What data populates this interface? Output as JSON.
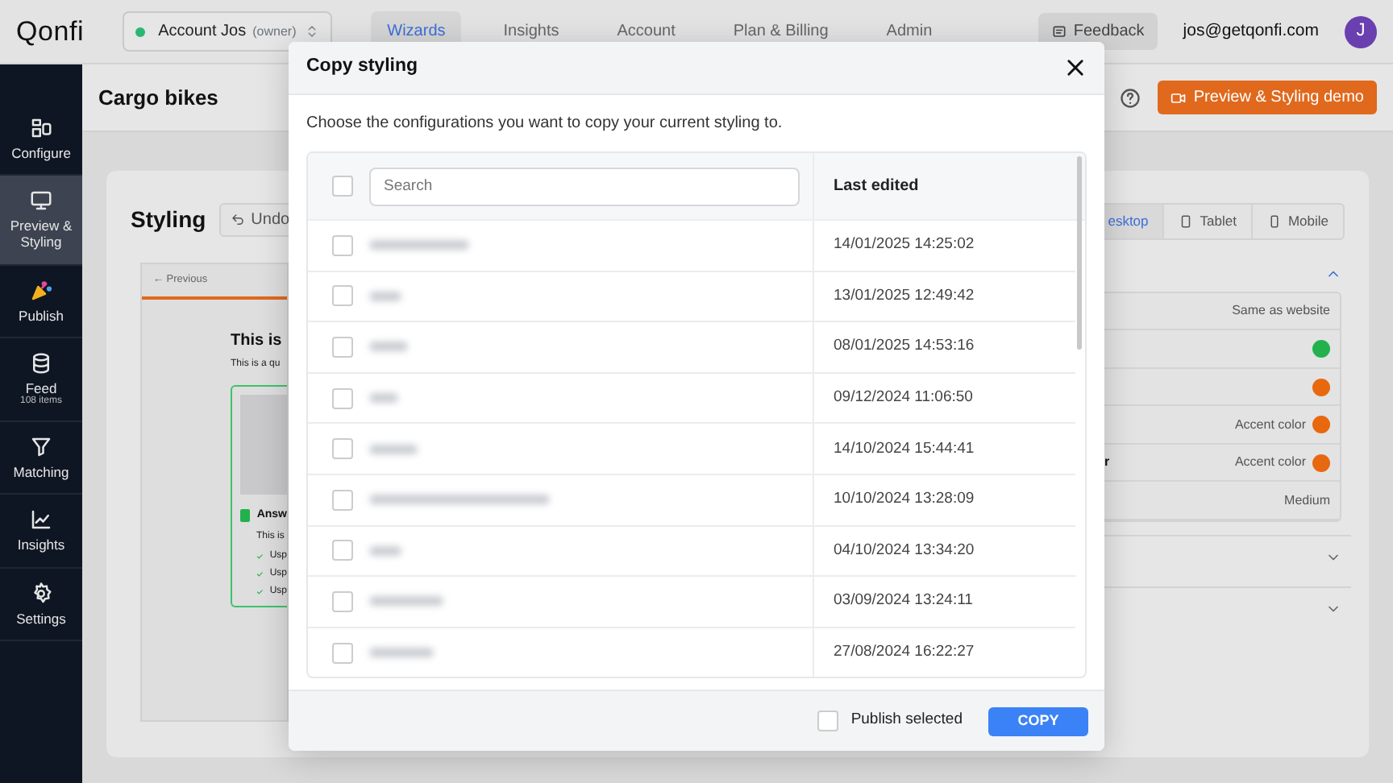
{
  "topbar": {
    "logo": "Qonfi",
    "account": {
      "name": "Account Jos",
      "role": "(owner)",
      "online": true
    },
    "nav": [
      {
        "label": "Wizards",
        "selected": true
      },
      {
        "label": "Insights",
        "selected": false
      },
      {
        "label": "Account",
        "selected": false
      },
      {
        "label": "Plan & Billing",
        "selected": false
      },
      {
        "label": "Admin",
        "selected": false
      }
    ],
    "feedback": "Feedback",
    "email": "jos@getqonfi.com",
    "avatar": "J"
  },
  "sidebar": {
    "items": [
      {
        "kind": "configure",
        "label": "Configure",
        "selected": false
      },
      {
        "kind": "preview",
        "label": "Preview & Styling",
        "selected": true
      },
      {
        "kind": "publish",
        "label": "Publish",
        "selected": false
      },
      {
        "kind": "feed",
        "label": "Feed",
        "sublabel": "108 items",
        "selected": false
      },
      {
        "kind": "matching",
        "label": "Matching",
        "selected": false
      },
      {
        "kind": "insights",
        "label": "Insights",
        "selected": false
      },
      {
        "kind": "settings",
        "label": "Settings",
        "selected": false
      }
    ]
  },
  "header": {
    "title": "Cargo bikes",
    "demo_button": "Preview & Styling demo"
  },
  "styling": {
    "title": "Styling",
    "undo": "Undo",
    "preview": {
      "previous": "← Previous",
      "heading": "This is",
      "text": "This is a qu",
      "answer": {
        "label": "Answ",
        "checked": true,
        "text": "This is",
        "usps": [
          "Usp",
          "Usp",
          "Usp"
        ]
      }
    },
    "devices": [
      {
        "label": "esktop",
        "selected": true
      },
      {
        "label": "Tablet",
        "selected": false
      },
      {
        "label": "Mobile",
        "selected": false
      }
    ],
    "sections": [
      {
        "expanded": true,
        "rows": [
          {
            "value": "Same as website"
          },
          {
            "color": "#22b14c"
          },
          {
            "color": "#e8680f"
          },
          {
            "value": "Accent color",
            "color": "#e8680f"
          },
          {
            "label": "r",
            "value": "Accent color",
            "color": "#e8680f"
          },
          {
            "value": "Medium"
          }
        ]
      },
      {
        "expanded": false
      },
      {
        "expanded": false
      }
    ]
  },
  "modal": {
    "title": "Copy styling",
    "description": "Choose the configurations you want to copy your current styling to.",
    "all_selected": false,
    "search": {
      "placeholder": "Search"
    },
    "column": "Last edited",
    "rows": [
      {
        "date": "14/01/2025 14:25:02",
        "selected": false
      },
      {
        "date": "13/01/2025 12:49:42",
        "selected": false
      },
      {
        "date": "08/01/2025 14:53:16",
        "selected": false
      },
      {
        "date": "09/12/2024 11:06:50",
        "selected": false
      },
      {
        "date": "14/10/2024 15:44:41",
        "selected": false
      },
      {
        "date": "10/10/2024 13:28:09",
        "selected": false
      },
      {
        "date": "04/10/2024 13:34:20",
        "selected": false
      },
      {
        "date": "03/09/2024 13:24:11",
        "selected": false
      },
      {
        "date": "27/08/2024 16:22:27",
        "selected": false
      }
    ],
    "publish_selected": {
      "label": "Publish selected",
      "checked": false
    },
    "copy_button": "COPY"
  }
}
